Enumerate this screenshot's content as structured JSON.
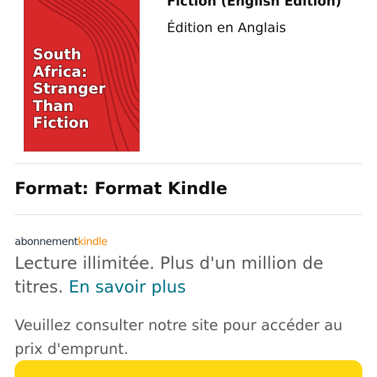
{
  "book": {
    "cover_title": "South\nAfrica:\nStranger\nThan\nFiction",
    "title_tail": "Fiction (English Edition)",
    "edition": "Édition en Anglais"
  },
  "format": {
    "label": "Format: Format Kindle"
  },
  "kindle_unlimited": {
    "logo_part1": "abonnement",
    "logo_part2": "kindle",
    "text": "Lecture illimitée. Plus d'un million de titres.",
    "link": "En savoir plus"
  },
  "borrow": {
    "text": "Veuillez consulter notre site pour accéder au prix d'emprunt."
  },
  "colors": {
    "cover_red": "#d8282a",
    "link_teal": "#007185",
    "button_yellow": "#ffd814",
    "kindle_orange": "#f08804"
  }
}
